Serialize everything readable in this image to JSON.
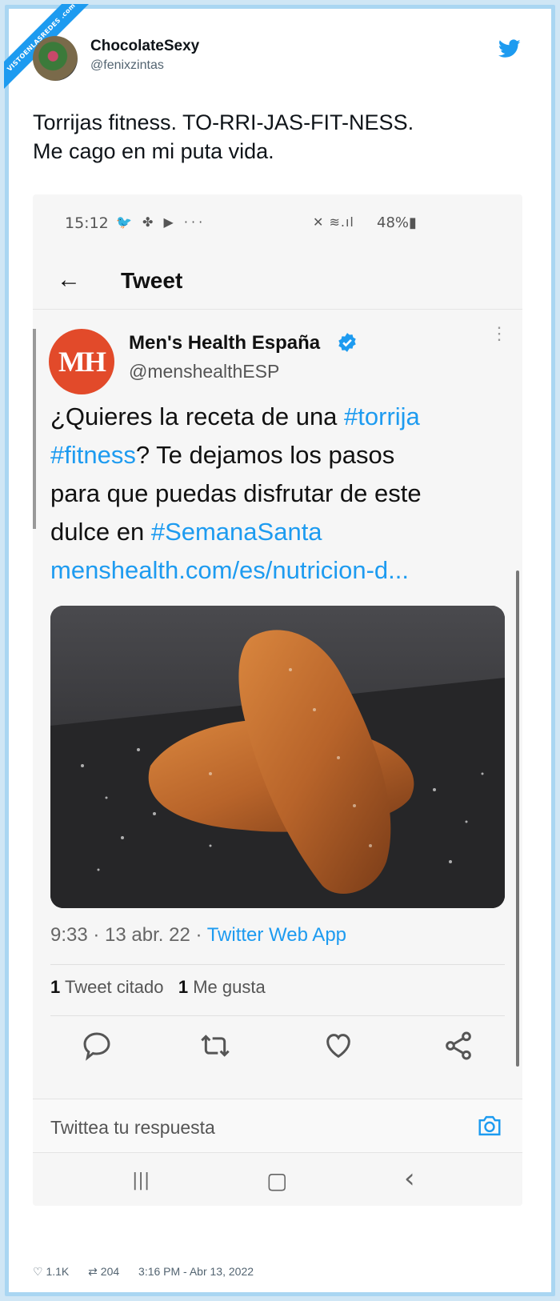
{
  "watermark": "VISTOENLASREDES .com",
  "tweet": {
    "author_name": "ChocolateSexy",
    "author_handle": "@fenixzintas",
    "text_line1": "Torrijas fitness. TO-RRI-JAS-FIT-NESS.",
    "text_line2": "Me cago en mi puta vida.",
    "likes": "1.1K",
    "retweets": "204",
    "timestamp": "3:16 PM - Abr 13, 2022"
  },
  "screenshot": {
    "status_bar": {
      "time": "15:12",
      "apps": "🐦 ✤ ▶ ···",
      "system": "✕ ≋.ıl",
      "battery": "48%▮"
    },
    "app_bar": {
      "back": "←",
      "title": "Tweet"
    },
    "quoted": {
      "logo": "MH",
      "name": "Men's Health España",
      "handle": "@menshealthESP",
      "more": "⋮",
      "line1_pre": "¿Quieres la receta de una ",
      "line1_tag": "#torrija",
      "line2_tag": "#fitness",
      "line2_post": "? Te dejamos los pasos",
      "line3": "para que puedas disfrutar de este",
      "line4_pre": "dulce en ",
      "line4_tag": "#SemanaSanta",
      "link": "menshealth.com/es/nutricion-d...",
      "meta_time": "9:33 · 13 abr. 22 · ",
      "meta_source": "Twitter Web App",
      "quotes_count": "1",
      "quotes_label": " Tweet citado",
      "likes_count": "1",
      "likes_label": " Me gusta"
    },
    "reply_placeholder": "Twittea tu respuesta",
    "nav": {
      "recent": "|||",
      "home": "▢",
      "back": "‹"
    }
  },
  "colors": {
    "brand": "#1d9bf0",
    "mh_red": "#e24a2a",
    "frame": "#a9d6f2"
  }
}
